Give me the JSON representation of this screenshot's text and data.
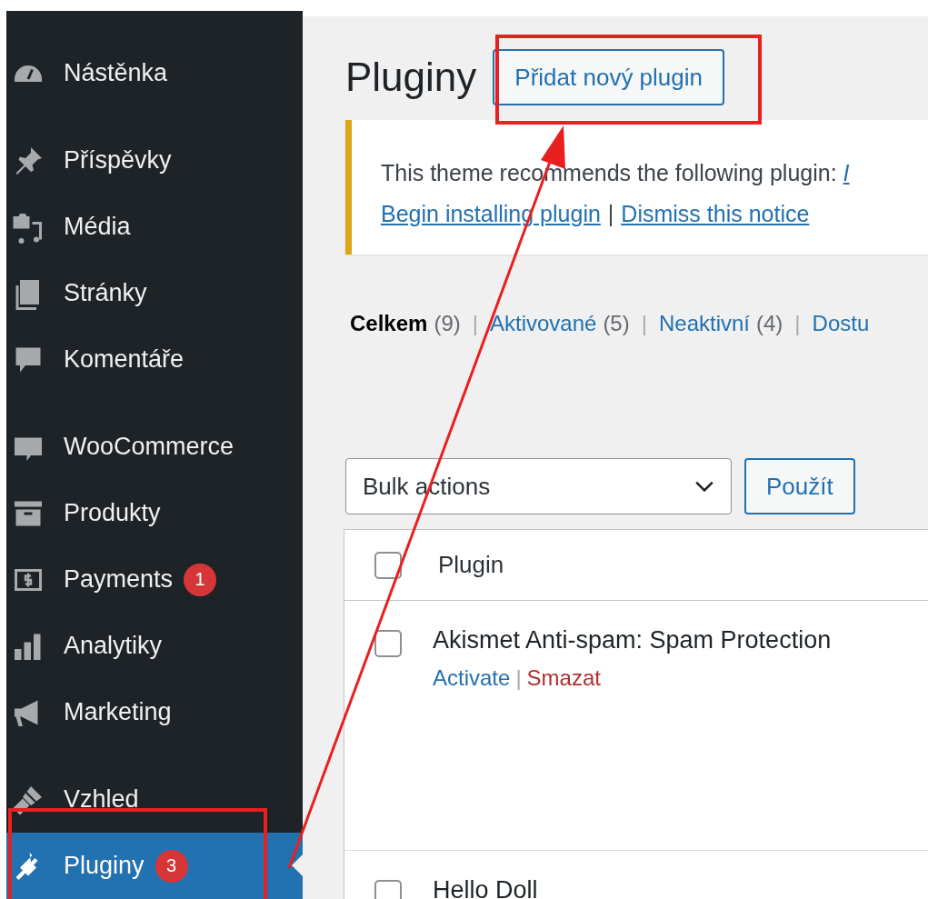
{
  "sidebar": {
    "groups": [
      [
        {
          "label": "Nástěnka",
          "selected": false
        }
      ],
      [
        {
          "label": "Příspěvky",
          "selected": false
        },
        {
          "label": "Média",
          "selected": false
        },
        {
          "label": "Stránky",
          "selected": false
        },
        {
          "label": "Komentáře",
          "selected": false
        }
      ],
      [
        {
          "label": "WooCommerce",
          "selected": false
        },
        {
          "label": "Produkty",
          "selected": false
        },
        {
          "label": "Payments",
          "selected": false,
          "badge": "1"
        },
        {
          "label": "Analytiky",
          "selected": false
        },
        {
          "label": "Marketing",
          "selected": false
        }
      ],
      [
        {
          "label": "Vzhled",
          "selected": false
        },
        {
          "label": "Pluginy",
          "selected": true,
          "badge": "3"
        }
      ]
    ]
  },
  "page": {
    "title": "Pluginy",
    "add_button": "Přidat nový plugin"
  },
  "notice": {
    "text": "This theme recommends the following plugin: ",
    "plugin_link": "I",
    "links": [
      "Begin installing plugin",
      "Dismiss this notice"
    ],
    "separator": "|"
  },
  "filters": [
    {
      "label": "Celkem",
      "count": "(9)",
      "selected": true
    },
    {
      "label": "Aktivované",
      "count": "(5)",
      "selected": false
    },
    {
      "label": "Neaktivní",
      "count": "(4)",
      "selected": false
    },
    {
      "label": "Dostu",
      "selected": false
    }
  ],
  "filter_separator": "|",
  "bulk": {
    "value": "Bulk actions",
    "apply": "Použít"
  },
  "table": {
    "header": {
      "label": "Plugin",
      "checked": false
    },
    "rows": [
      {
        "name": "Akismet Anti-spam: Spam Protection",
        "checked": false,
        "actions": [
          {
            "label": "Activate",
            "kind": "link"
          },
          {
            "label": "Smazat",
            "kind": "delete"
          }
        ]
      },
      {
        "name": "Hello Doll",
        "checked": false,
        "actions": []
      }
    ],
    "action_separator": "|"
  }
}
